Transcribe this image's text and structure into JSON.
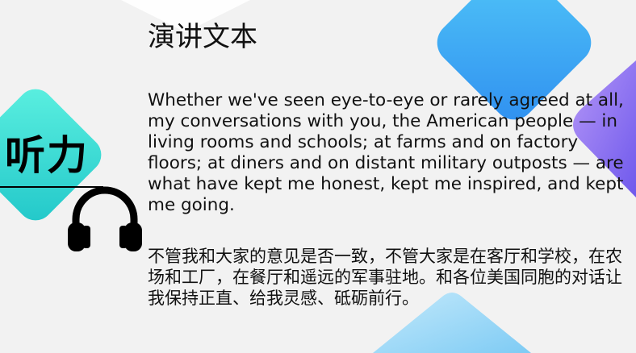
{
  "slide": {
    "title": "演讲文本",
    "english_text": "Whether we've seen eye-to-eye or rarely agreed at all, my conversations with you, the American people — in living rooms and schools; at farms and on factory floors; at diners and on distant military outposts — are what have kept me honest, kept me inspired, and kept me going.",
    "chinese_text": "不管我和大家的意见是否一致，不管大家是在客厅和学校，在农场和工厂，在餐厅和遥远的军事驻地。和各位美国同胞的对话让我保持正直、给我灵感、砥砺前行。",
    "badge_label": "听力"
  },
  "colors": {
    "teal": "#36e4d8",
    "blue": "#3fb0f5",
    "purple": "#8d6cf2",
    "light_blue": "#a8dcf7"
  },
  "icons": [
    "headphones-icon"
  ]
}
